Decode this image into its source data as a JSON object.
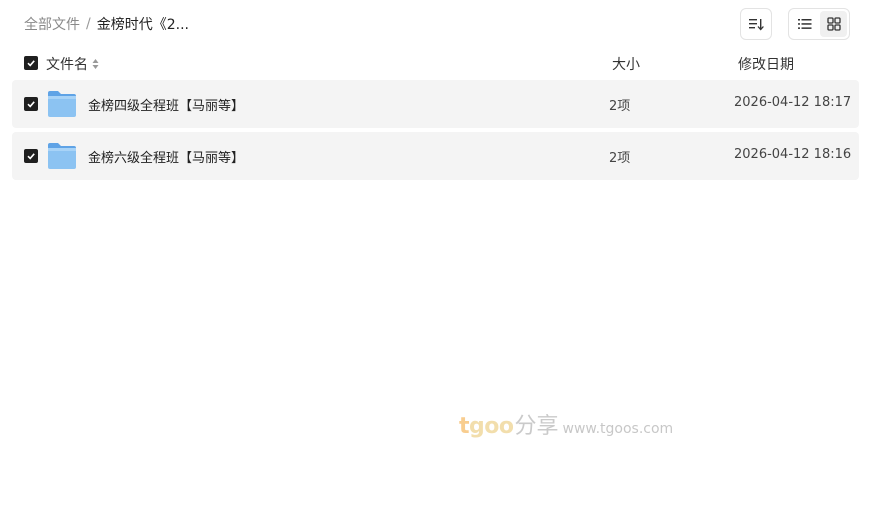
{
  "breadcrumb": {
    "root": "全部文件",
    "separator": "/",
    "current": "金榜时代《2..."
  },
  "toolbar": {
    "sort_icon": "sort-icon",
    "list_view_icon": "list-view-icon",
    "grid_view_icon": "grid-view-icon"
  },
  "table": {
    "columns": {
      "name": "文件名",
      "size": "大小",
      "date": "修改日期"
    },
    "rows": [
      {
        "name": "金榜四级全程班【马丽等】",
        "size": "2项",
        "date": "2026-04-12 18:17",
        "checked": true,
        "icon": "folder-icon"
      },
      {
        "name": "金榜六级全程班【马丽等】",
        "size": "2项",
        "date": "2026-04-12 18:16",
        "checked": true,
        "icon": "folder-icon"
      }
    ]
  },
  "watermark": {
    "logo_t": "t",
    "logo_goo": "goo",
    "share": "分享",
    "url": "www.tgoos.com"
  },
  "colors": {
    "row_bg": "#f4f4f4",
    "checkbox": "#1f1f1f",
    "folder": "#7fb8ee"
  }
}
